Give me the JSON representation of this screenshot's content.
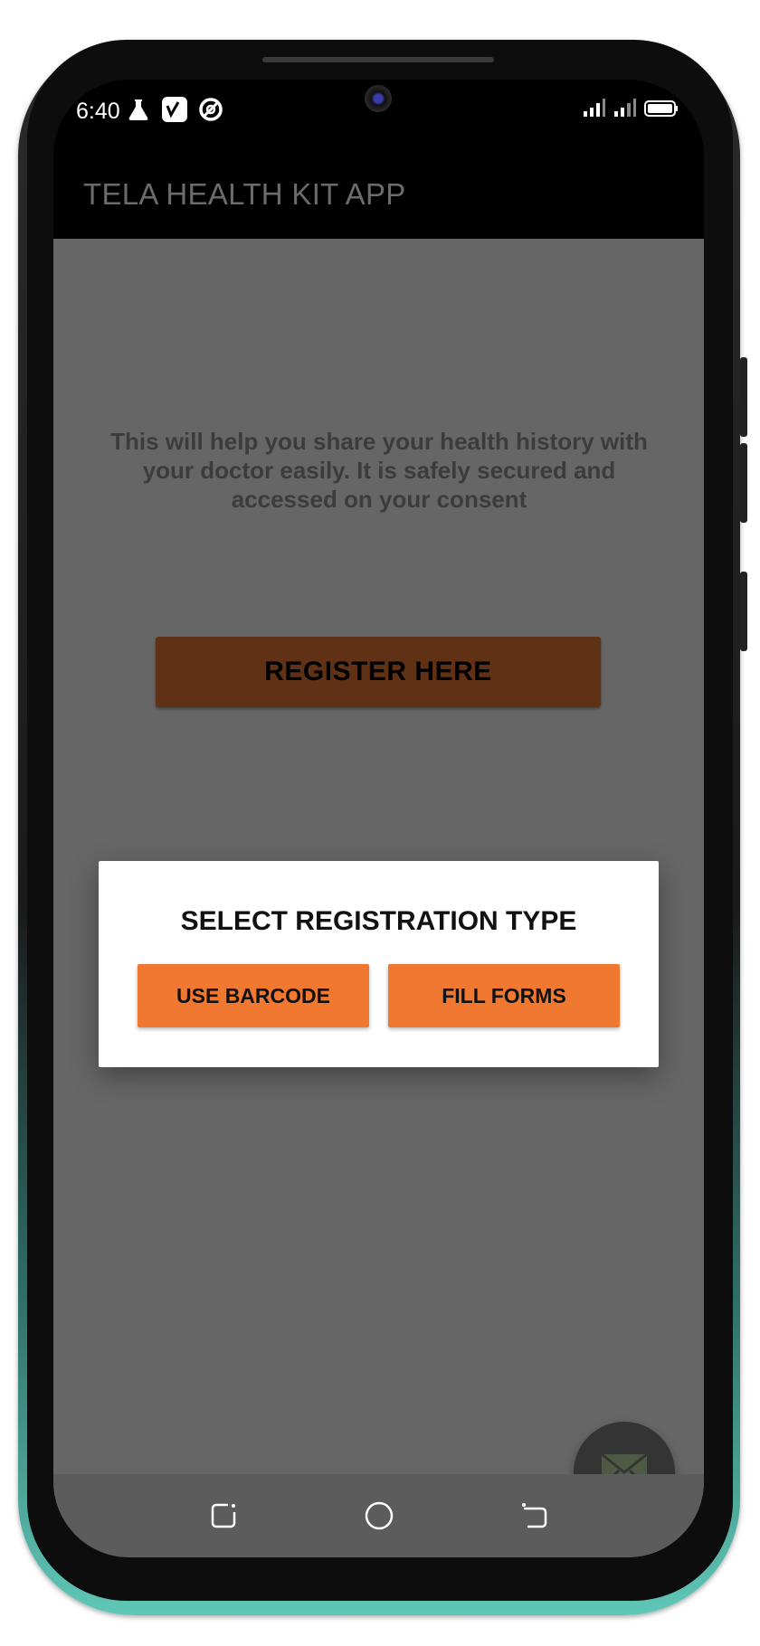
{
  "status_bar": {
    "time": "6:40",
    "left_icons": [
      "flask-icon",
      "vimeo-icon",
      "circle-slash-icon"
    ],
    "right_icons": [
      "signal-icon",
      "signal-icon-2",
      "battery-icon"
    ]
  },
  "app_bar": {
    "title": "TELA HEALTH KIT APP"
  },
  "main": {
    "intro_text": "This will help you share your health history with your doctor easily. It is safely secured and accessed on your consent",
    "register_button": "REGISTER HERE",
    "fab_icon": "mail-icon"
  },
  "dialog": {
    "title": "SELECT REGISTRATION TYPE",
    "buttons": {
      "barcode": "USE BARCODE",
      "forms": "FILL FORMS"
    }
  },
  "nav_bar": {
    "icons": [
      "recent-apps-icon",
      "home-icon",
      "back-icon"
    ]
  },
  "colors": {
    "accent": "#f07830",
    "accent_dimmed": "#613115",
    "scrim": "#666666",
    "app_bar": "#000000",
    "dialog_bg": "#ffffff"
  }
}
